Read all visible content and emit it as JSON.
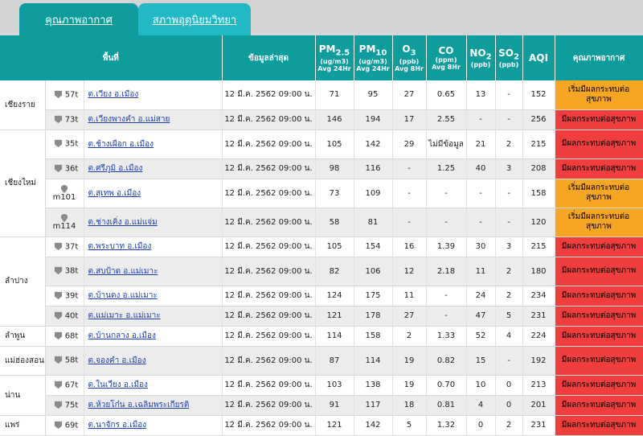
{
  "tabs": [
    {
      "label": "คุณภาพอากาศ",
      "active": true
    },
    {
      "label": "สภาพอุตุนิยมวิทยา",
      "active": false
    }
  ],
  "headers": {
    "area": "พื้นที่",
    "latest": "ข้อมูลล่าสุด",
    "pm25": {
      "name": "PM2.5",
      "main": "PM",
      "sub": "2.5",
      "unit": "(ug/m3)",
      "avg": "Avg 24Hr"
    },
    "pm10": {
      "name": "PM10",
      "main": "PM",
      "sub": "10",
      "unit": "(ug/m3)",
      "avg": "Avg 24Hr"
    },
    "o3": {
      "name": "O3",
      "main": "O",
      "sub": "3",
      "unit": "(ppb)",
      "avg": "Avg 8Hr"
    },
    "co": {
      "name": "CO",
      "unit": "(ppm)",
      "avg": "Avg 8Hr"
    },
    "no2": {
      "name": "NO2",
      "main": "NO",
      "sub": "2",
      "unit": "(ppb)"
    },
    "so2": {
      "name": "SO2",
      "main": "SO",
      "sub": "2",
      "unit": "(ppb)"
    },
    "aqi": "AQI",
    "quality": "คุณภาพอากาศ"
  },
  "rows": [
    {
      "province": "เชียงราย",
      "span": 2,
      "code": "57t",
      "area": "ต.เวียง อ.เมือง",
      "time": "12 มี.ค. 2562 09:00 น.",
      "pm25": "71",
      "pm10": "95",
      "o3": "27",
      "co": "0.65",
      "no2": "13",
      "so2": "-",
      "aqi": "152",
      "quality": "เริ่มมีผลกระทบต่อสุขภาพ",
      "level": "orange"
    },
    {
      "code": "73t",
      "area": "ต.เวียงพางคำ อ.แม่สาย",
      "time": "12 มี.ค. 2562 09:00 น.",
      "pm25": "146",
      "pm10": "194",
      "o3": "17",
      "co": "2.55",
      "no2": "-",
      "so2": "-",
      "aqi": "256",
      "quality": "มีผลกระทบต่อสุขภาพ",
      "level": "red"
    },
    {
      "province": "เชียงใหม่",
      "span": 4,
      "code": "35t",
      "area": "ต.ช้างเผือก อ.เมือง",
      "time": "12 มี.ค. 2562 09:00 น.",
      "pm25": "105",
      "pm10": "142",
      "o3": "29",
      "co": "ไม่มีข้อมูล",
      "no2": "21",
      "so2": "2",
      "aqi": "215",
      "quality": "มีผลกระทบต่อสุขภาพ",
      "level": "red"
    },
    {
      "code": "36t",
      "area": "ต.ศรีภูมิ อ.เมือง",
      "time": "12 มี.ค. 2562 09:00 น.",
      "pm25": "98",
      "pm10": "116",
      "o3": "-",
      "co": "1.25",
      "no2": "40",
      "so2": "3",
      "aqi": "208",
      "quality": "มีผลกระทบต่อสุขภาพ",
      "level": "red"
    },
    {
      "code": "m101",
      "mobile": true,
      "area": "ต.สุเทพ อ.เมือง",
      "time": "12 มี.ค. 2562 09:00 น.",
      "pm25": "73",
      "pm10": "109",
      "o3": "-",
      "co": "-",
      "no2": "-",
      "so2": "-",
      "aqi": "158",
      "quality": "เริ่มมีผลกระทบต่อสุขภาพ",
      "level": "orange"
    },
    {
      "code": "m114",
      "mobile": true,
      "area": "ต.ช่างเคิ่ง อ.แม่แจ่ม",
      "time": "12 มี.ค. 2562 09:00 น.",
      "pm25": "58",
      "pm10": "81",
      "o3": "-",
      "co": "-",
      "no2": "-",
      "so2": "-",
      "aqi": "120",
      "quality": "เริ่มมีผลกระทบต่อสุขภาพ",
      "level": "orange"
    },
    {
      "province": "ลำปาง",
      "span": 4,
      "code": "37t",
      "area": "ต.พระบาท อ.เมือง",
      "time": "12 มี.ค. 2562 09:00 น.",
      "pm25": "105",
      "pm10": "154",
      "o3": "16",
      "co": "1.39",
      "no2": "30",
      "so2": "3",
      "aqi": "215",
      "quality": "มีผลกระทบต่อสุขภาพ",
      "level": "red"
    },
    {
      "code": "38t",
      "area": "ต.สบป้าด อ.แม่เมาะ",
      "time": "12 มี.ค. 2562 09:00 น.",
      "pm25": "82",
      "pm10": "106",
      "o3": "12",
      "co": "2.18",
      "no2": "11",
      "so2": "2",
      "aqi": "180",
      "quality": "มีผลกระทบต่อสุขภาพ",
      "level": "red"
    },
    {
      "code": "39t",
      "area": "ต.บ้านดง อ.แม่เมาะ",
      "time": "12 มี.ค. 2562 09:00 น.",
      "pm25": "124",
      "pm10": "175",
      "o3": "11",
      "co": "-",
      "no2": "24",
      "so2": "2",
      "aqi": "234",
      "quality": "มีผลกระทบต่อสุขภาพ",
      "level": "red"
    },
    {
      "code": "40t",
      "area": "ต.แม่เมาะ อ.แม่เมาะ",
      "time": "12 มี.ค. 2562 09:00 น.",
      "pm25": "121",
      "pm10": "178",
      "o3": "27",
      "co": "-",
      "no2": "47",
      "so2": "5",
      "aqi": "231",
      "quality": "มีผลกระทบต่อสุขภาพ",
      "level": "red"
    },
    {
      "province": "ลำพูน",
      "span": 1,
      "code": "68t",
      "area": "ต.บ้านกลาง อ.เมือง",
      "time": "12 มี.ค. 2562 09:00 น.",
      "pm25": "114",
      "pm10": "158",
      "o3": "2",
      "co": "1.33",
      "no2": "52",
      "so2": "4",
      "aqi": "224",
      "quality": "มีผลกระทบต่อสุขภาพ",
      "level": "red"
    },
    {
      "province": "แม่ฮ่องสอน",
      "span": 1,
      "code": "58t",
      "area": "ต.จองคำ อ.เมือง",
      "time": "12 มี.ค. 2562 09:00 น.",
      "pm25": "87",
      "pm10": "114",
      "o3": "19",
      "co": "0.82",
      "no2": "15",
      "so2": "-",
      "aqi": "192",
      "quality": "มีผลกระทบต่อสุขภาพ",
      "level": "red"
    },
    {
      "province": "น่าน",
      "span": 2,
      "code": "67t",
      "area": "ต.ในเวียง อ.เมือง",
      "time": "12 มี.ค. 2562 09:00 น.",
      "pm25": "103",
      "pm10": "138",
      "o3": "19",
      "co": "0.70",
      "no2": "10",
      "so2": "0",
      "aqi": "213",
      "quality": "มีผลกระทบต่อสุขภาพ",
      "level": "red"
    },
    {
      "code": "75t",
      "area": "ต.ห้วยโก๋น อ.เฉลิมพระเกียรติ",
      "time": "12 มี.ค. 2562 09:00 น.",
      "pm25": "91",
      "pm10": "117",
      "o3": "18",
      "co": "0.81",
      "no2": "4",
      "so2": "0",
      "aqi": "201",
      "quality": "มีผลกระทบต่อสุขภาพ",
      "level": "red"
    },
    {
      "province": "แพร่",
      "span": 1,
      "code": "69t",
      "area": "ต.นาจักร อ.เมือง",
      "time": "12 มี.ค. 2562 09:00 น.",
      "pm25": "121",
      "pm10": "142",
      "o3": "5",
      "co": "1.32",
      "no2": "0",
      "so2": "2",
      "aqi": "231",
      "quality": "มีผลกระทบต่อสุขภาพ",
      "level": "red"
    }
  ]
}
